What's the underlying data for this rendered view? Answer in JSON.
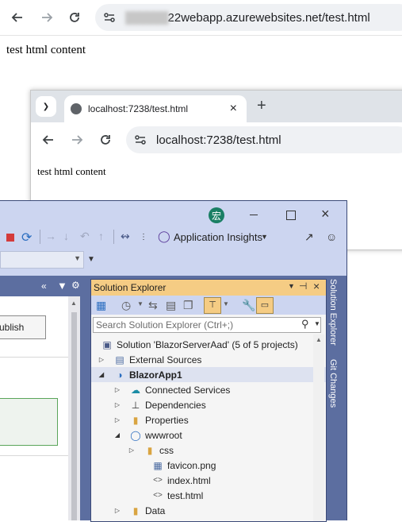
{
  "back_window": {
    "url_blurred": "██████",
    "url": "22webapp.azurewebsites.net/test.html",
    "content": "test html content"
  },
  "front_window": {
    "tab_title": "localhost:7238/test.html",
    "url": "localhost:7238/test.html",
    "content": "test html content"
  },
  "vs": {
    "app_insights": "Application Insights",
    "publish_fragment": "ublish",
    "solution_explorer": {
      "title": "Solution Explorer",
      "search_placeholder": "Search Solution Explorer (Ctrl+;)",
      "side_tabs": [
        "Solution Explorer",
        "Git Changes"
      ],
      "items": [
        {
          "label": "Solution 'BlazorServerAad' (5 of 5 projects)",
          "icon": "solution-icon"
        },
        {
          "label": "External Sources",
          "icon": "external-sources-icon"
        },
        {
          "label": "BlazorApp1",
          "icon": "web-project-icon"
        },
        {
          "label": "Connected Services",
          "icon": "connected-services-icon"
        },
        {
          "label": "Dependencies",
          "icon": "dependencies-icon"
        },
        {
          "label": "Properties",
          "icon": "properties-folder-icon"
        },
        {
          "label": "wwwroot",
          "icon": "globe-icon"
        },
        {
          "label": "css",
          "icon": "folder-icon"
        },
        {
          "label": "favicon.png",
          "icon": "image-file-icon"
        },
        {
          "label": "index.html",
          "icon": "html-file-icon"
        },
        {
          "label": "test.html",
          "icon": "html-file-icon"
        },
        {
          "label": "Data",
          "icon": "folder-icon"
        }
      ]
    }
  },
  "colors": {
    "vs_blue": "#5c6ea0",
    "vs_toolbar": "#ccd5f0",
    "vs_se_title": "#f5cc84",
    "vs_avatar": "#1a7f64"
  }
}
